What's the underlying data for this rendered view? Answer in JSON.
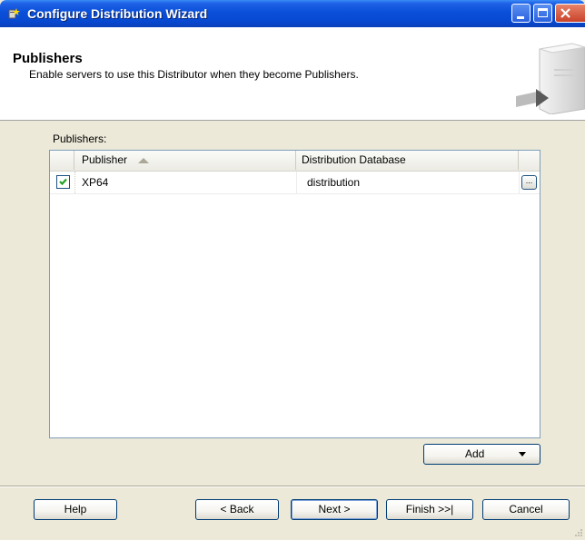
{
  "window": {
    "title": "Configure Distribution Wizard",
    "icon": "wizard-icon",
    "controls": [
      "minimize-icon",
      "maximize-icon",
      "close-icon"
    ]
  },
  "header": {
    "title": "Publishers",
    "subtitle": "Enable servers to use this Distributor when they become Publishers.",
    "graphic": "server-graphic-icon"
  },
  "publishers": {
    "label": "Publishers:",
    "columns": [
      "Publisher",
      "Distribution Database"
    ],
    "sort": {
      "column": "Publisher",
      "direction": "ascending"
    },
    "rows": [
      {
        "checked": true,
        "publisher": "XP64",
        "database": "distribution"
      }
    ]
  },
  "buttons": {
    "add": "Add",
    "help": "Help",
    "back": "< Back",
    "next": "Next >",
    "finish": "Finish >>|",
    "cancel": "Cancel"
  },
  "colors": {
    "titlebar": "#0a4fd9",
    "dialog_bg": "#ece9d8",
    "grid_border": "#7f9db9",
    "checkmark": "#21a121"
  }
}
